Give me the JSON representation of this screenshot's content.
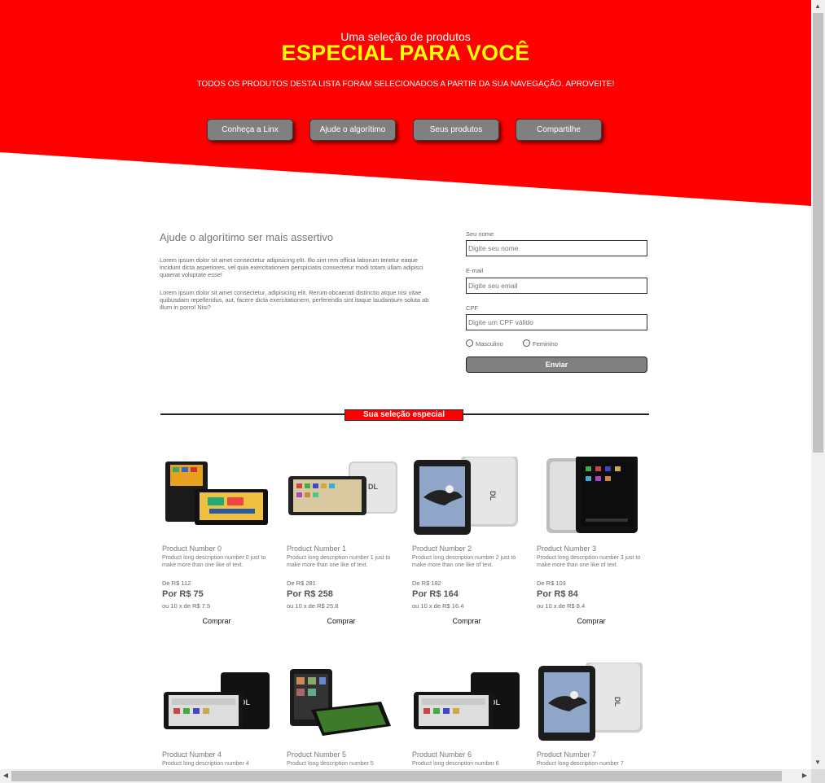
{
  "hero": {
    "subtitle": "Uma seleção de produtos",
    "title": "ESPECIAL PARA VOCÊ",
    "description": "TODOS OS PRODUTOS DESTA LISTA FORAM SELECIONADOS A PARTIR DA SUA NAVEGAÇÃO. APROVEITE!",
    "bg_color": "#ff0000",
    "title_color": "#ffff00"
  },
  "nav": {
    "buttons": [
      "Conheça a Linx",
      "Ajude o algorítimo",
      "Seus produtos",
      "Compartilhe"
    ]
  },
  "help": {
    "title": "Ajude o algorítimo ser mais assertivo",
    "paragraph1": "Lorem ipsum dolor sit amet consectetur adipisicing elit. Illo sint rem officia laborum tenetur eaque incidunt dicta asperiores, vel quia exercitationem perspiciatis consectetur modi totam ullam adipisci quaerat voluptate esse!",
    "paragraph2": "Lorem ipsum dolor sit amet consectetur, adipisicing elit. Rerum obcaecati distinctio atque nisi vitae quibusdam repellendus, aut, facere dicta exercitationem, perferendis sint itaque laudantium soluta ab illum in porro! Nisi?"
  },
  "form": {
    "name_label": "Seu nome",
    "name_placeholder": "Digite seu nome",
    "email_label": "E-mail",
    "email_placeholder": "Digite seu email",
    "cpf_label": "CPF",
    "cpf_placeholder": "Digite um CPF válido",
    "gender_options": [
      "Masculino",
      "Feminino"
    ],
    "submit_label": "Enviar"
  },
  "section": {
    "badge": "Sua seleção especial"
  },
  "products": [
    {
      "name": "Product Number 0",
      "description": "Product long description number 0 just to make more than one like of text.",
      "old_price": "De R$ 112",
      "price_prefix": "Por ",
      "price": "R$ 75",
      "installments": "ou 10 x de R$ 7.5",
      "buy": "Comprar",
      "image": "tablet-in-case"
    },
    {
      "name": "Product Number 1",
      "description": "Product long description number 1 just to make more than one like of text.",
      "old_price": "De R$ 281",
      "price_prefix": "Por ",
      "price": "R$ 258",
      "installments": "ou 10 x de R$ 25.8",
      "buy": "Comprar",
      "image": "tablet-wide-front-back"
    },
    {
      "name": "Product Number 2",
      "description": "Product long description number 2 just to make more than one like of text.",
      "old_price": "De R$ 182",
      "price_prefix": "Por ",
      "price": "R$ 164",
      "installments": "ou 10 x de R$ 16.4",
      "buy": "Comprar",
      "image": "tablet-eagle-silver"
    },
    {
      "name": "Product Number 3",
      "description": "Product long description number 3 just to make more than one like of text.",
      "old_price": "De R$ 103",
      "price_prefix": "Por ",
      "price": "R$ 84",
      "installments": "ou 10 x de R$ 8.4",
      "buy": "Comprar",
      "image": "tablet-silver-black"
    },
    {
      "name": "Product Number 4",
      "description": "Product long description number 4",
      "image": "tablet-black-front-back"
    },
    {
      "name": "Product Number 5",
      "description": "Product long description number 5",
      "image": "tablet-tilted-pair"
    },
    {
      "name": "Product Number 6",
      "description": "Product long description number 6",
      "image": "tablet-black-front-back"
    },
    {
      "name": "Product Number 7",
      "description": "Product long description number 7",
      "image": "tablet-eagle-silver"
    }
  ]
}
